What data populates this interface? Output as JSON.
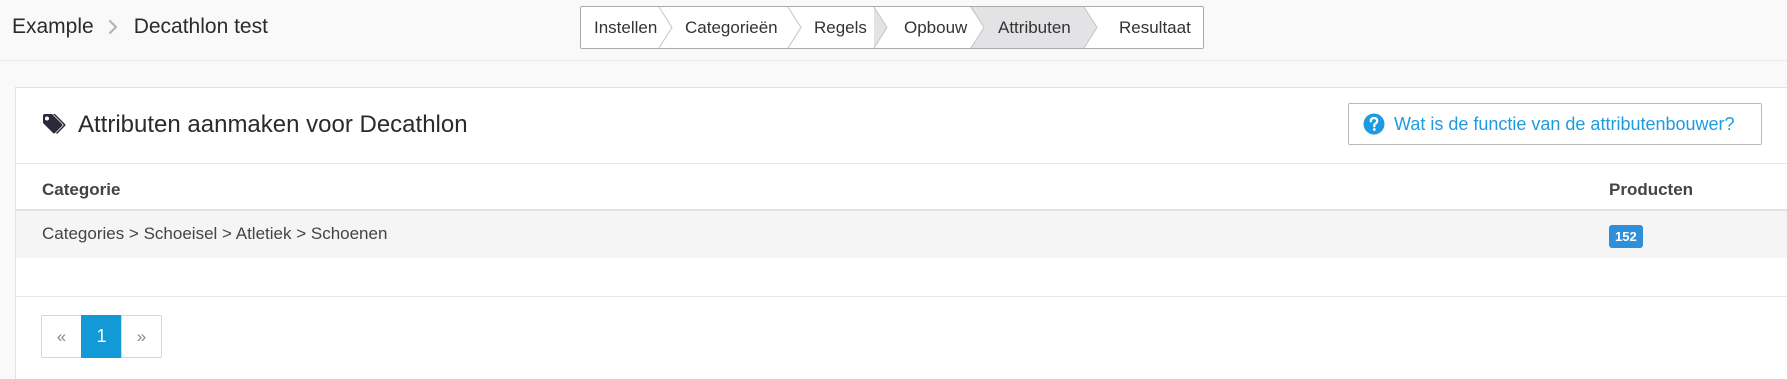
{
  "breadcrumb": {
    "items": [
      "Example",
      "Decathlon test"
    ],
    "separator_icon": "chevron-right-icon"
  },
  "wizard": {
    "steps": [
      {
        "label": "Instellen",
        "active": false
      },
      {
        "label": "Categorieën",
        "active": false
      },
      {
        "label": "Regels",
        "active": false
      },
      {
        "label": "Opbouw",
        "active": false
      },
      {
        "label": "Attributen",
        "active": true
      },
      {
        "label": "Resultaat",
        "active": false
      }
    ]
  },
  "panel": {
    "title": "Attributen aanmaken voor Decathlon",
    "title_icon": "tags-icon",
    "help_button": {
      "label": "Wat is de functie van de attributenbouwer?",
      "icon": "question-circle-icon"
    }
  },
  "table": {
    "headers": {
      "category": "Categorie",
      "products": "Producten"
    },
    "rows": [
      {
        "category": "Categories > Schoeisel > Atletiek > Schoenen",
        "products": "152"
      }
    ]
  },
  "pagination": {
    "prev": "«",
    "pages": [
      "1"
    ],
    "current": "1",
    "next": "»"
  },
  "colors": {
    "accent": "#139ad6",
    "link": "#1e9be0",
    "badge": "#2f8fd8",
    "active_step": "#e3e3e6"
  }
}
